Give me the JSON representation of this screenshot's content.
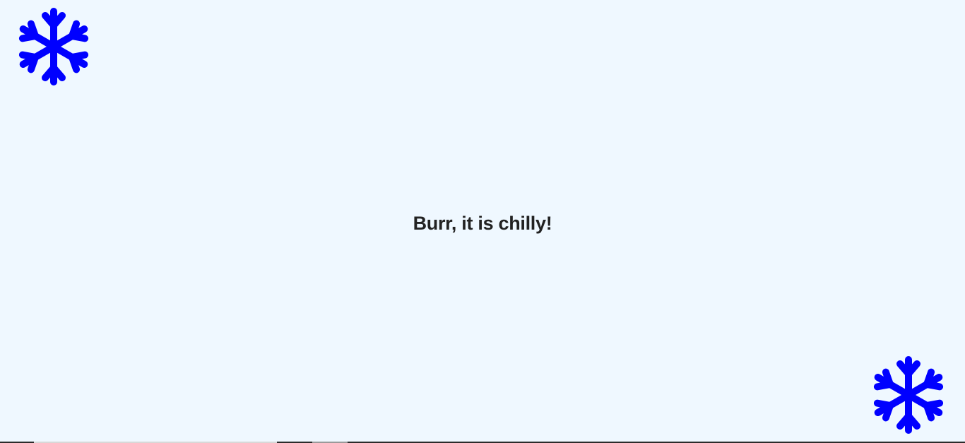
{
  "message": {
    "text": "Burr, it is chilly!"
  },
  "icons": {
    "top_left": "snowflake-icon",
    "bottom_right": "snowflake-icon"
  },
  "colors": {
    "background": "#eff8ff",
    "snowflake": "#0000ff",
    "text": "#222222"
  }
}
